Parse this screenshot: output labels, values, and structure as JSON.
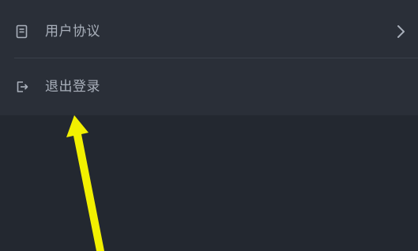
{
  "menu": {
    "items": [
      {
        "label": "用户协议",
        "icon": "document-icon",
        "has_chevron": true
      },
      {
        "label": "退出登录",
        "icon": "logout-icon",
        "has_chevron": false
      }
    ]
  },
  "colors": {
    "background": "#232830",
    "panel": "#2a2f38",
    "text": "#a9b0bb",
    "annotation_arrow": "#f2f000"
  }
}
